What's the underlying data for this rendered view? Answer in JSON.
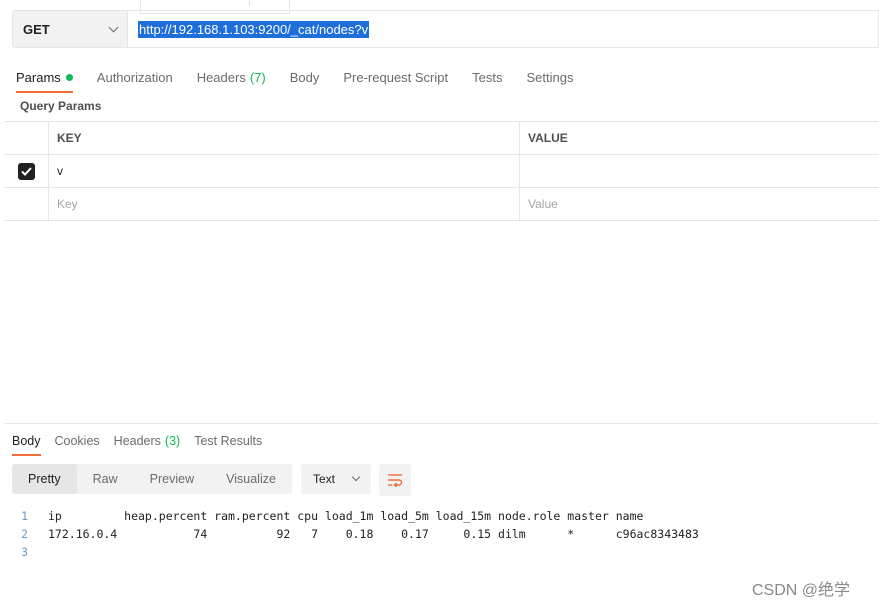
{
  "request": {
    "method": "GET",
    "url": "http://192.168.1.103:9200/_cat/nodes?v"
  },
  "request_tabs": [
    {
      "label": "Params",
      "active": true,
      "dot": true
    },
    {
      "label": "Authorization"
    },
    {
      "label": "Headers",
      "count": "(7)"
    },
    {
      "label": "Body"
    },
    {
      "label": "Pre-request Script"
    },
    {
      "label": "Tests"
    },
    {
      "label": "Settings"
    }
  ],
  "query_params": {
    "title": "Query Params",
    "headers": {
      "key": "KEY",
      "value": "VALUE"
    },
    "rows": [
      {
        "checked": true,
        "key": "v",
        "value": ""
      }
    ],
    "placeholder": {
      "key": "Key",
      "value": "Value"
    }
  },
  "response_tabs": [
    {
      "label": "Body",
      "active": true
    },
    {
      "label": "Cookies"
    },
    {
      "label": "Headers",
      "count": "(3)"
    },
    {
      "label": "Test Results"
    }
  ],
  "view_modes": [
    "Pretty",
    "Raw",
    "Preview",
    "Visualize"
  ],
  "active_view": "Pretty",
  "format": "Text",
  "response_lines": [
    {
      "n": "1",
      "text": "ip         heap.percent ram.percent cpu load_1m load_5m load_15m node.role master name"
    },
    {
      "n": "2",
      "text": "172.16.0.4           74          92   7    0.18    0.17     0.15 dilm      *      c96ac8343483"
    },
    {
      "n": "3",
      "text": ""
    }
  ],
  "watermark": "CSDN @绝学",
  "colors": {
    "accent": "#f26b3a",
    "count_green": "#0cbb52",
    "selection": "#1e6fd9"
  }
}
